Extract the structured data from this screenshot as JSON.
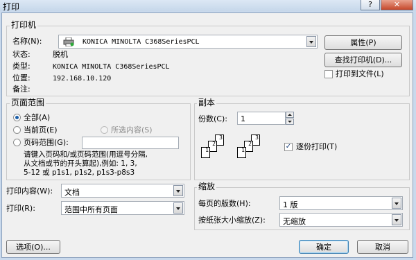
{
  "window": {
    "title": "打印",
    "help_label": "?",
    "close_label": "✕"
  },
  "printer": {
    "group_label": "打印机",
    "name_label": "名称(N):",
    "name_value": "KONICA MINOLTA C368SeriesPCL",
    "status_label": "状态:",
    "status_value": "脱机",
    "type_label": "类型:",
    "type_value": "KONICA MINOLTA C368SeriesPCL",
    "location_label": "位置:",
    "location_value": "192.168.10.120",
    "comment_label": "备注:",
    "properties_button": "属性(P)",
    "find_button": "查找打印机(D)...",
    "print_to_file_label": "打印到文件(L)",
    "print_to_file_checked": false
  },
  "page_range": {
    "group_label": "页面范围",
    "all_label": "全部(A)",
    "current_label": "当前页(E)",
    "selection_label": "所选内容(S)",
    "pages_label": "页码范围(G):",
    "pages_value": "",
    "hint_line1": "请键入页码和/或页码范围(用逗号分隔,",
    "hint_line2": "从文档或节的开头算起),例如: 1, 3,",
    "hint_line3": "5-12 或 p1s1, p1s2, p1s3-p8s3",
    "selected": "all"
  },
  "copies": {
    "group_label": "副本",
    "count_label": "份数(C):",
    "count_value": "1",
    "collate_label": "逐份打印(T)",
    "collate_checked": true,
    "page_numbers": [
      "1",
      "2",
      "3"
    ]
  },
  "print_what": {
    "label": "打印内容(W):",
    "value": "文档"
  },
  "print": {
    "label": "打印(R):",
    "value": "范围中所有页面"
  },
  "zoom": {
    "group_label": "缩放",
    "pages_per_sheet_label": "每页的版数(H):",
    "pages_per_sheet_value": "1 版",
    "scale_label": "按纸张大小缩放(Z):",
    "scale_value": "无缩放"
  },
  "footer": {
    "options_button": "选项(O)...",
    "ok_button": "确定",
    "cancel_button": "取消"
  }
}
